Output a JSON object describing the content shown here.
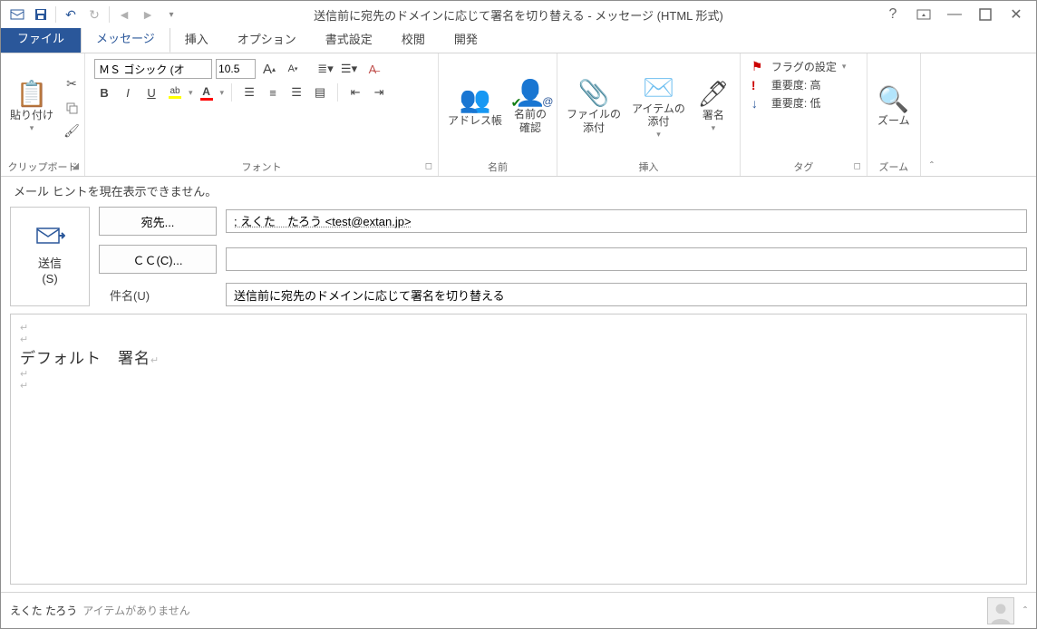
{
  "window": {
    "title": "送信前に宛先のドメインに応じて署名を切り替える - メッセージ (HTML 形式)"
  },
  "tabs": {
    "file": "ファイル",
    "message": "メッセージ",
    "insert": "挿入",
    "options": "オプション",
    "format": "書式設定",
    "review": "校閲",
    "developer": "開発"
  },
  "ribbon": {
    "clipboard": {
      "label": "クリップボード",
      "paste": "貼り付け"
    },
    "font": {
      "label": "フォント",
      "name": "ＭＳ ゴシック (オ",
      "size": "10.5"
    },
    "names": {
      "label": "名前",
      "address": "アドレス帳",
      "check": "名前の\n確認"
    },
    "include": {
      "label": "挿入",
      "attach_file": "ファイルの\n添付",
      "attach_item": "アイテムの\n添付",
      "signature": "署名"
    },
    "tags": {
      "label": "タグ",
      "flag": "フラグの設定",
      "high": "重要度: 高",
      "low": "重要度: 低"
    },
    "zoom": {
      "label": "ズーム",
      "btn": "ズーム"
    }
  },
  "hint": "メール ヒントを現在表示できません。",
  "header": {
    "send": "送信\n(S)",
    "to_btn": "宛先...",
    "to_value": "; えくた　たろう <test@extan.jp>",
    "cc_btn": "ＣＣ(C)...",
    "cc_value": "",
    "subject_label": "件名(U)",
    "subject_value": "送信前に宛先のドメインに応じて署名を切り替える"
  },
  "body": {
    "signature": "デフォルト　署名"
  },
  "status": {
    "user": "えくた たろう",
    "items": "アイテムがありません"
  }
}
